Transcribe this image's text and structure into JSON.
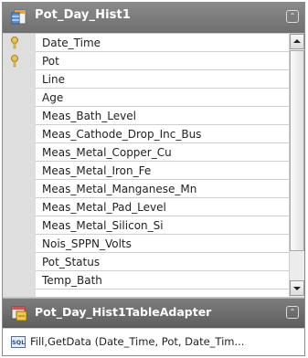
{
  "table": {
    "title": "Pot_Day_Hist1",
    "collapse_glyph": "⌃",
    "columns": [
      {
        "name": "Date_Time",
        "key": true
      },
      {
        "name": "Pot",
        "key": true
      },
      {
        "name": "Line",
        "key": false
      },
      {
        "name": "Age",
        "key": false
      },
      {
        "name": "Meas_Bath_Level",
        "key": false
      },
      {
        "name": "Meas_Cathode_Drop_Inc_Bus",
        "key": false
      },
      {
        "name": "Meas_Metal_Copper_Cu",
        "key": false
      },
      {
        "name": "Meas_Metal_Iron_Fe",
        "key": false
      },
      {
        "name": "Meas_Metal_Manganese_Mn",
        "key": false
      },
      {
        "name": "Meas_Metal_Pad_Level",
        "key": false
      },
      {
        "name": "Meas_Metal_Silicon_Si",
        "key": false
      },
      {
        "name": "Nois_SPPN_Volts",
        "key": false
      },
      {
        "name": "Pot_Status",
        "key": false
      },
      {
        "name": "Temp_Bath",
        "key": false
      }
    ],
    "scroll_position": 0.0
  },
  "adapter": {
    "title": "Pot_Day_Hist1TableAdapter",
    "collapse_glyph": "⌃",
    "query": "Fill,GetData (Date_Time, Pot, Date_Tim...",
    "query_icon_label": "SQL"
  },
  "colors": {
    "header": "#7b7b7b",
    "key": "#e4c35a"
  }
}
